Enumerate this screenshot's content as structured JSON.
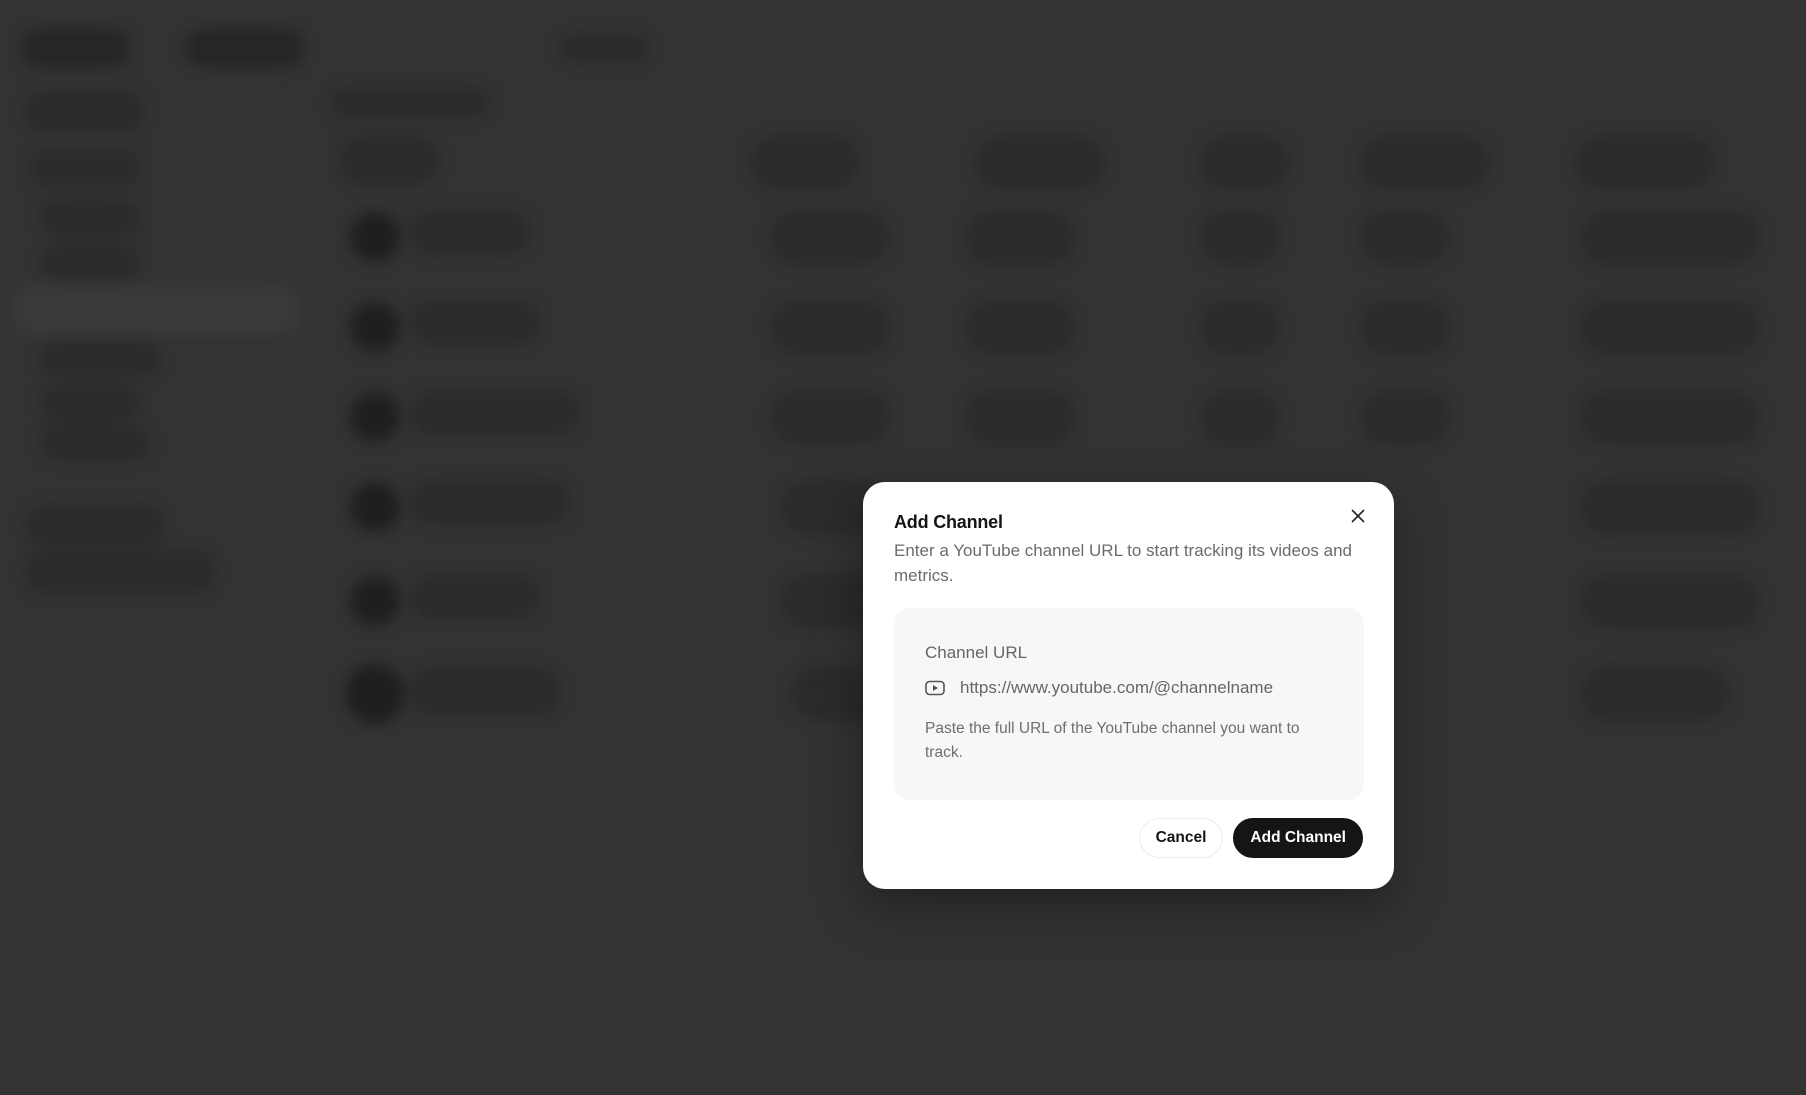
{
  "modal": {
    "title": "Add Channel",
    "description": "Enter a YouTube channel URL to start tracking its videos and metrics.",
    "field_label": "Channel URL",
    "url_placeholder": "https://www.youtube.com/@channelname",
    "url_value": "",
    "helper_text": "Paste the full URL of the YouTube channel you want to track.",
    "cancel_label": "Cancel",
    "submit_label": "Add Channel",
    "icons": {
      "close": "close-icon",
      "input": "youtube-icon"
    }
  },
  "colors": {
    "overlay": "#333333",
    "primary_button": "#151515",
    "form_card": "#f7f7f7"
  }
}
